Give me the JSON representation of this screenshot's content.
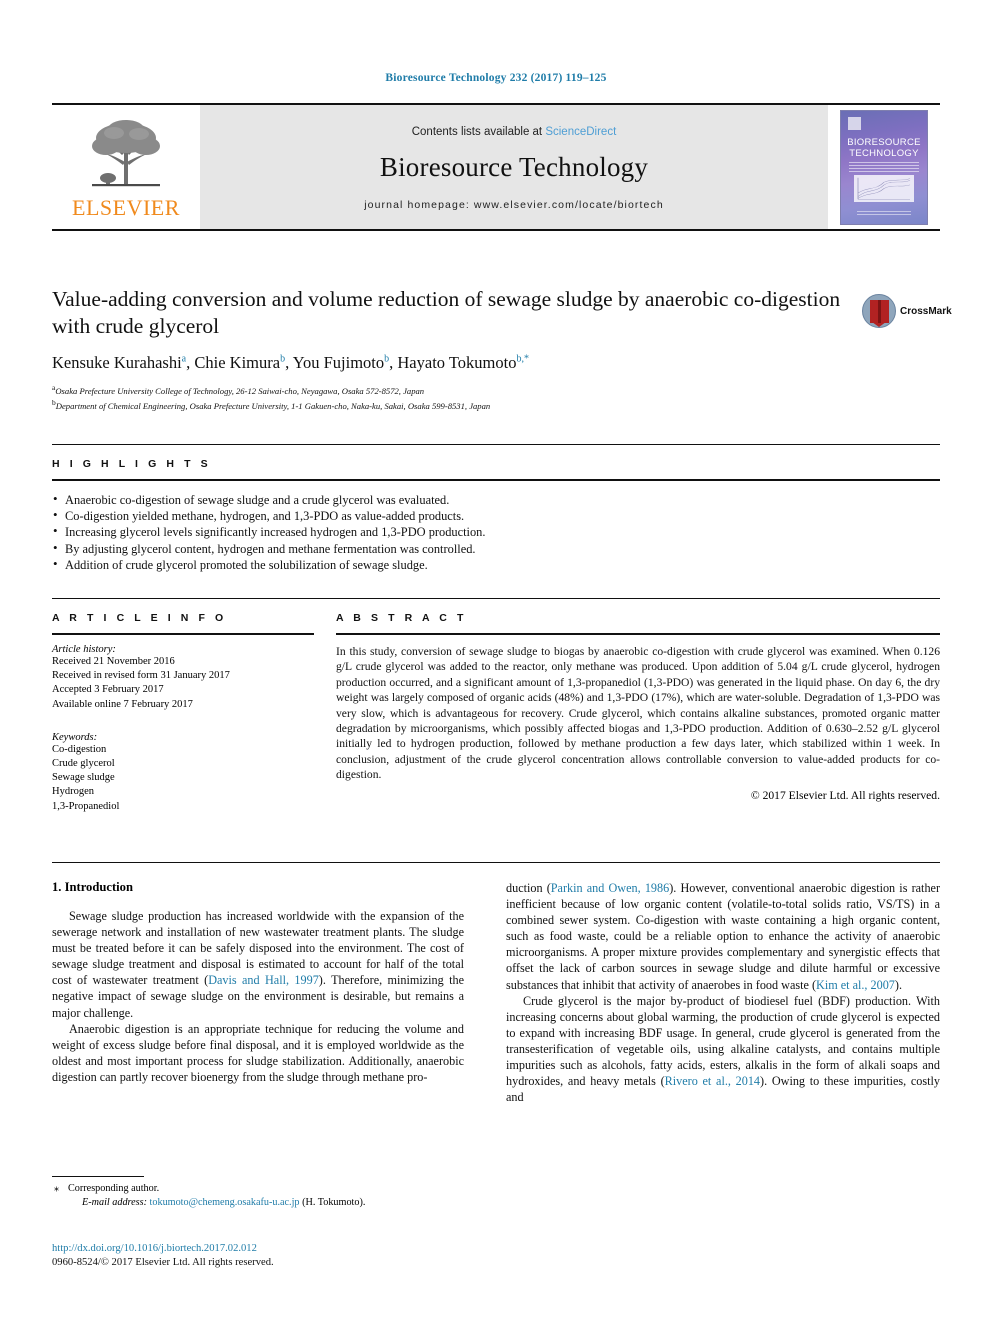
{
  "running_head": "Bioresource Technology 232 (2017) 119–125",
  "masthead": {
    "publisher": "ELSEVIER",
    "contents_prefix": "Contents lists available at ",
    "contents_link": "ScienceDirect",
    "journal_title": "Bioresource Technology",
    "homepage": "journal homepage: www.elsevier.com/locate/biortech",
    "cover_title_line1": "BIORESOURCE",
    "cover_title_line2": "TECHNOLOGY"
  },
  "article": {
    "title": "Value-adding conversion and volume reduction of sewage sludge by anaerobic co-digestion with crude glycerol",
    "authors": [
      {
        "name": "Kensuke Kurahashi",
        "mark": "a"
      },
      {
        "name": "Chie Kimura",
        "mark": "b"
      },
      {
        "name": "You Fujimoto",
        "mark": "b"
      },
      {
        "name": "Hayato Tokumoto",
        "mark": "b,*"
      }
    ],
    "affiliations": [
      {
        "mark": "a",
        "text": "Osaka Prefecture University College of Technology, 26-12 Saiwai-cho, Neyagawa, Osaka 572-8572, Japan"
      },
      {
        "mark": "b",
        "text": "Department of Chemical Engineering, Osaka Prefecture University, 1-1 Gakuen-cho, Naka-ku, Sakai, Osaka 599-8531, Japan"
      }
    ],
    "crossmark_label": "CrossMark"
  },
  "highlights": {
    "heading": "H I G H L I G H T S",
    "items": [
      "Anaerobic co-digestion of sewage sludge and a crude glycerol was evaluated.",
      "Co-digestion yielded methane, hydrogen, and 1,3-PDO as value-added products.",
      "Increasing glycerol levels significantly increased hydrogen and 1,3-PDO production.",
      "By adjusting glycerol content, hydrogen and methane fermentation was controlled.",
      "Addition of crude glycerol promoted the solubilization of sewage sludge."
    ]
  },
  "article_info": {
    "heading": "A R T I C L E   I N F O",
    "history_label": "Article history:",
    "history": [
      "Received 21 November 2016",
      "Received in revised form 31 January 2017",
      "Accepted 3 February 2017",
      "Available online 7 February 2017"
    ],
    "keywords_label": "Keywords:",
    "keywords": [
      "Co-digestion",
      "Crude glycerol",
      "Sewage sludge",
      "Hydrogen",
      "1,3-Propanediol"
    ]
  },
  "abstract": {
    "heading": "A B S T R A C T",
    "text": "In this study, conversion of sewage sludge to biogas by anaerobic co-digestion with crude glycerol was examined. When 0.126 g/L crude glycerol was added to the reactor, only methane was produced. Upon addition of 5.04 g/L crude glycerol, hydrogen production occurred, and a significant amount of 1,3-propanediol (1,3-PDO) was generated in the liquid phase. On day 6, the dry weight was largely composed of organic acids (48%) and 1,3-PDO (17%), which are water-soluble. Degradation of 1,3-PDO was very slow, which is advantageous for recovery. Crude glycerol, which contains alkaline substances, promoted organic matter degradation by microorganisms, which possibly affected biogas and 1,3-PDO production. Addition of 0.630–2.52 g/L glycerol initially led to hydrogen production, followed by methane production a few days later, which stabilized within 1 week. In conclusion, adjustment of the crude glycerol concentration allows controllable conversion to value-added products for co-digestion.",
    "copyright": "© 2017 Elsevier Ltd. All rights reserved."
  },
  "body": {
    "section_title": "1. Introduction",
    "left": {
      "p1_a": "Sewage sludge production has increased worldwide with the expansion of the sewerage network and installation of new wastewater treatment plants. The sludge must be treated before it can be safely disposed into the environment. The cost of sewage sludge treatment and disposal is estimated to account for half of the total cost of wastewater treatment (",
      "p1_cite": "Davis and Hall, 1997",
      "p1_b": "). Therefore, minimizing the negative impact of sewage sludge on the environment is desirable, but remains a major challenge.",
      "p2": "Anaerobic digestion is an appropriate technique for reducing the volume and weight of excess sludge before final disposal, and it is employed worldwide as the oldest and most important process for sludge stabilization. Additionally, anaerobic digestion can partly recover bioenergy from the sludge through methane pro-"
    },
    "right": {
      "p2_a": "duction (",
      "p2_cite1": "Parkin and Owen, 1986",
      "p2_b": "). However, conventional anaerobic digestion is rather inefficient because of low organic content (volatile-to-total solids ratio, VS/TS) in a combined sewer system. Co-digestion with waste containing a high organic content, such as food waste, could be a reliable option to enhance the activity of anaerobic microorganisms. A proper mixture provides complementary and synergistic effects that offset the lack of carbon sources in sewage sludge and dilute harmful or excessive substances that inhibit that activity of anaerobes in food waste (",
      "p2_cite2": "Kim et al., 2007",
      "p2_c": ").",
      "p3_a": "Crude glycerol is the major by-product of biodiesel fuel (BDF) production. With increasing concerns about global warming, the production of crude glycerol is expected to expand with increasing BDF usage. In general, crude glycerol is generated from the transesterification of vegetable oils, using alkaline catalysts, and contains multiple impurities such as alcohols, fatty acids, esters, alkalis in the form of alkali soaps and hydroxides, and heavy metals (",
      "p3_cite": "Rivero et al., 2014",
      "p3_b": "). Owing to these impurities, costly and"
    }
  },
  "footer": {
    "corresponding_star": "⁎",
    "corresponding_label": "Corresponding author.",
    "email_label": "E-mail address:",
    "email": "tokumoto@chemeng.osakafu-u.ac.jp",
    "email_owner": "(H. Tokumoto).",
    "doi": "http://dx.doi.org/10.1016/j.biortech.2017.02.012",
    "issn": "0960-8524/© 2017 Elsevier Ltd. All rights reserved."
  },
  "colors": {
    "link_blue": "#1f7ca8",
    "sciencedirect_blue": "#4e9ed4",
    "elsevier_orange": "#f08a1d"
  }
}
